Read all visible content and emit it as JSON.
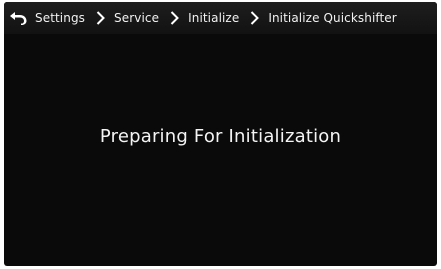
{
  "header": {
    "back_icon": "back-arrow-icon",
    "breadcrumb": [
      {
        "label": "Settings"
      },
      {
        "label": "Service"
      },
      {
        "label": "Initialize"
      },
      {
        "label": "Initialize Quickshifter"
      }
    ],
    "separator_icon": "chevron-right-icon"
  },
  "main": {
    "message": "Preparing For Initialization"
  },
  "colors": {
    "background": "#0a0a0a",
    "topbar": "#1a1a1a",
    "text": "#ffffff"
  }
}
